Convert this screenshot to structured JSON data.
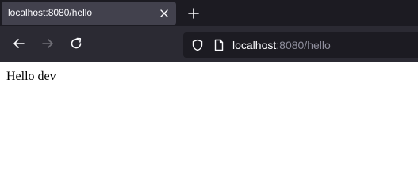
{
  "tab": {
    "title": "localhost:8080/hello",
    "close_icon": "close-icon"
  },
  "new_tab_icon": "plus-icon",
  "navigation": {
    "back_icon": "arrow-left-icon",
    "forward_icon": "arrow-right-icon",
    "reload_icon": "reload-icon"
  },
  "urlbar": {
    "security_icon": "shield-icon",
    "page_icon": "page-icon",
    "host": "localhost",
    "rest": ":8080/hello"
  },
  "content": {
    "text": "Hello dev"
  },
  "colors": {
    "tabstrip_bg": "#1c1b22",
    "active_tab_bg": "#42414d",
    "toolbar_bg": "#2b2a33",
    "urlbar_bg": "#1c1b22",
    "text_light": "#fbfbfe",
    "text_dim": "#8f8f9d"
  }
}
